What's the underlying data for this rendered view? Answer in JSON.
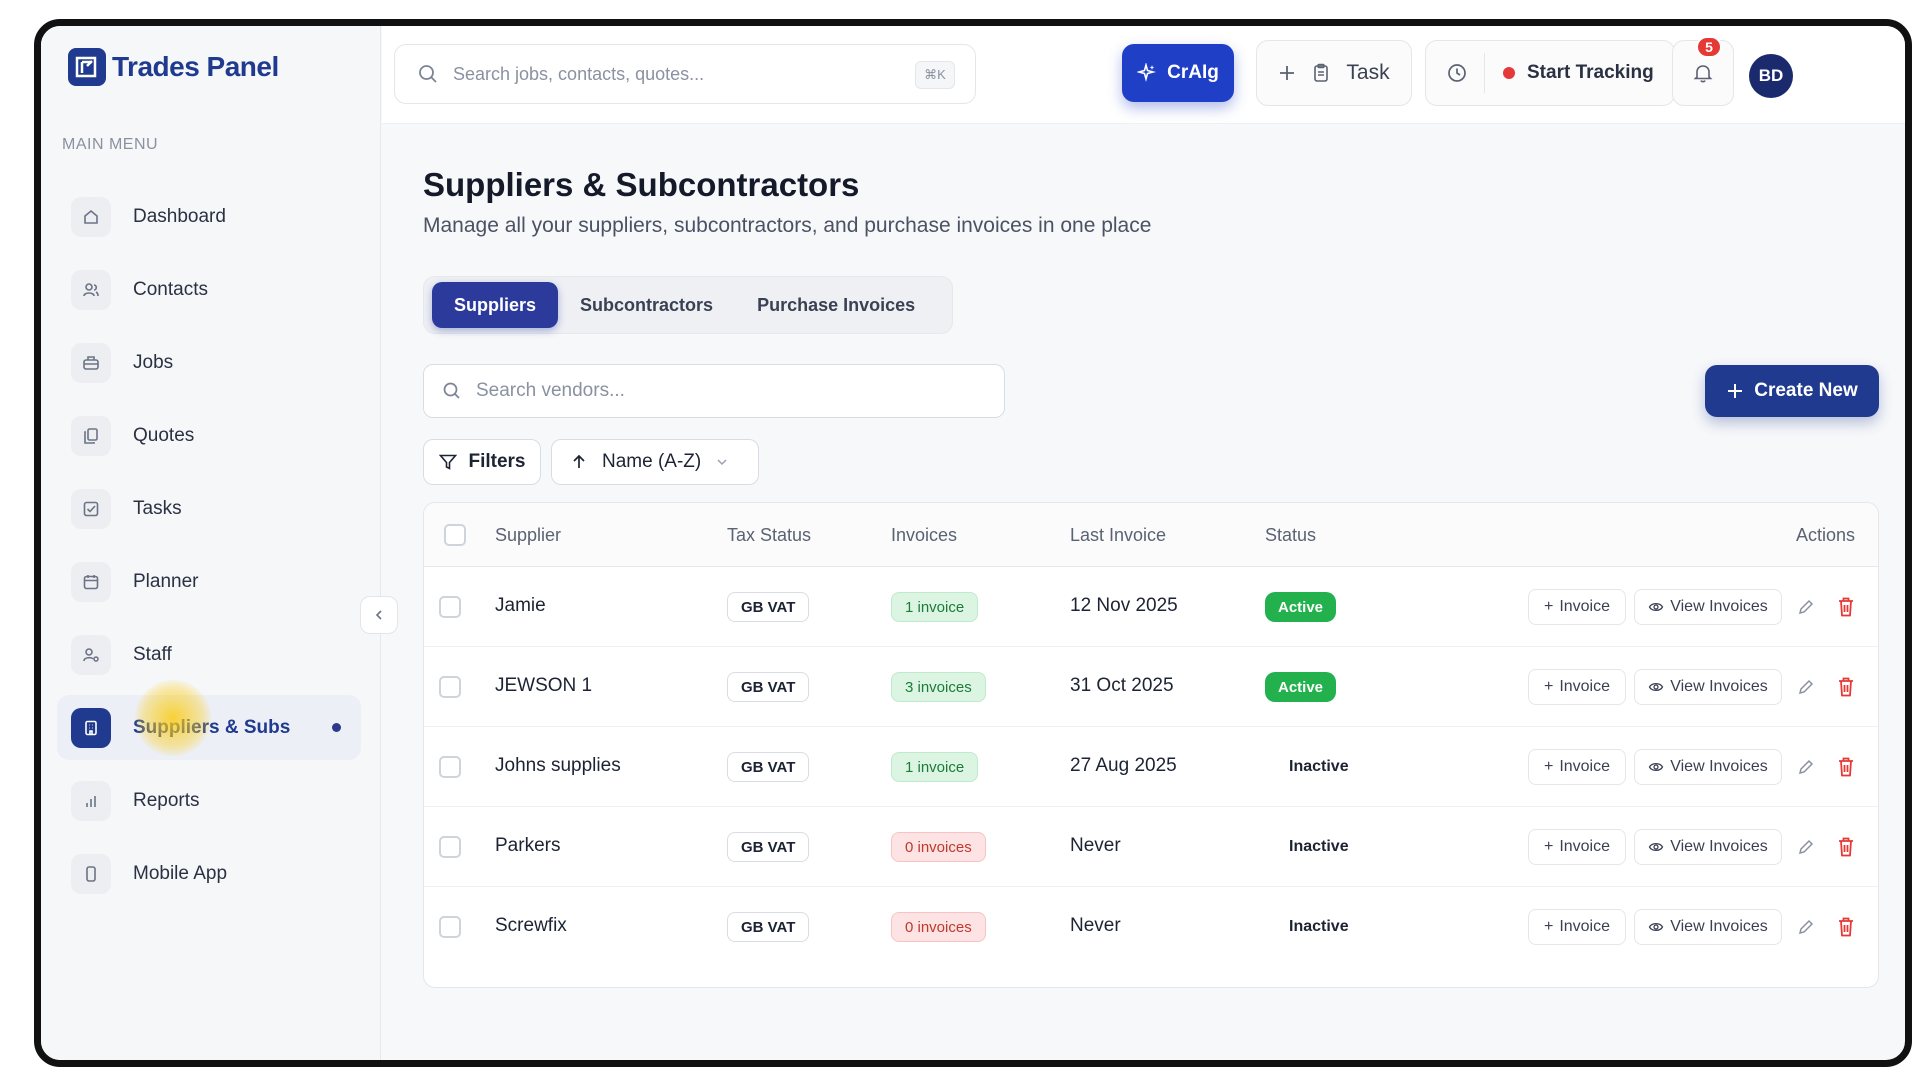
{
  "app": {
    "name": "Trades Panel"
  },
  "sidebar": {
    "menu_title": "MAIN MENU",
    "items": [
      {
        "label": "Dashboard",
        "icon": "home-icon"
      },
      {
        "label": "Contacts",
        "icon": "users-icon"
      },
      {
        "label": "Jobs",
        "icon": "briefcase-icon"
      },
      {
        "label": "Quotes",
        "icon": "copy-icon"
      },
      {
        "label": "Tasks",
        "icon": "checkbox-icon"
      },
      {
        "label": "Planner",
        "icon": "calendar-icon"
      },
      {
        "label": "Staff",
        "icon": "staff-icon"
      },
      {
        "label": "Suppliers & Subs",
        "icon": "building-icon",
        "active": true
      },
      {
        "label": "Reports",
        "icon": "bar-chart-icon"
      },
      {
        "label": "Mobile App",
        "icon": "phone-icon"
      }
    ]
  },
  "topbar": {
    "search_placeholder": "Search jobs, contacts, quotes...",
    "search_shortcut": "⌘K",
    "ai_label": "CrAIg",
    "task_label": "Task",
    "tracking_label": "Start Tracking",
    "notification_count": "5",
    "avatar_initials": "BD"
  },
  "page": {
    "title": "Suppliers & Subcontractors",
    "subtitle": "Manage all your suppliers, subcontractors, and purchase invoices in one place",
    "tabs": [
      {
        "label": "Suppliers",
        "active": true
      },
      {
        "label": "Subcontractors"
      },
      {
        "label": "Purchase Invoices"
      }
    ],
    "vendor_search_placeholder": "Search vendors...",
    "create_label": "Create New",
    "filters_label": "Filters",
    "sort_label": "Name (A-Z)"
  },
  "table": {
    "headers": {
      "supplier": "Supplier",
      "tax": "Tax Status",
      "invoices": "Invoices",
      "last": "Last Invoice",
      "status": "Status",
      "actions": "Actions"
    },
    "action_labels": {
      "invoice": "Invoice",
      "view": "View Invoices"
    },
    "rows": [
      {
        "name": "Jamie",
        "tax": "GB VAT",
        "invoices": "1 invoice",
        "last": "12 Nov 2025",
        "status": "Active"
      },
      {
        "name": "JEWSON 1",
        "tax": "GB VAT",
        "invoices": "3 invoices",
        "last": "31 Oct 2025",
        "status": "Active"
      },
      {
        "name": "Johns supplies",
        "tax": "GB VAT",
        "invoices": "1 invoice",
        "last": "27 Aug 2025",
        "status": "Inactive"
      },
      {
        "name": "Parkers",
        "tax": "GB VAT",
        "invoices": "0 invoices",
        "last": "Never",
        "status": "Inactive"
      },
      {
        "name": "Screwfix",
        "tax": "GB VAT",
        "invoices": "0 invoices",
        "last": "Never",
        "status": "Inactive"
      }
    ]
  },
  "colors": {
    "brand": "#1f3a8f",
    "ai_button": "#1f3fc7",
    "active_status": "#22b14c",
    "danger": "#e53935"
  }
}
